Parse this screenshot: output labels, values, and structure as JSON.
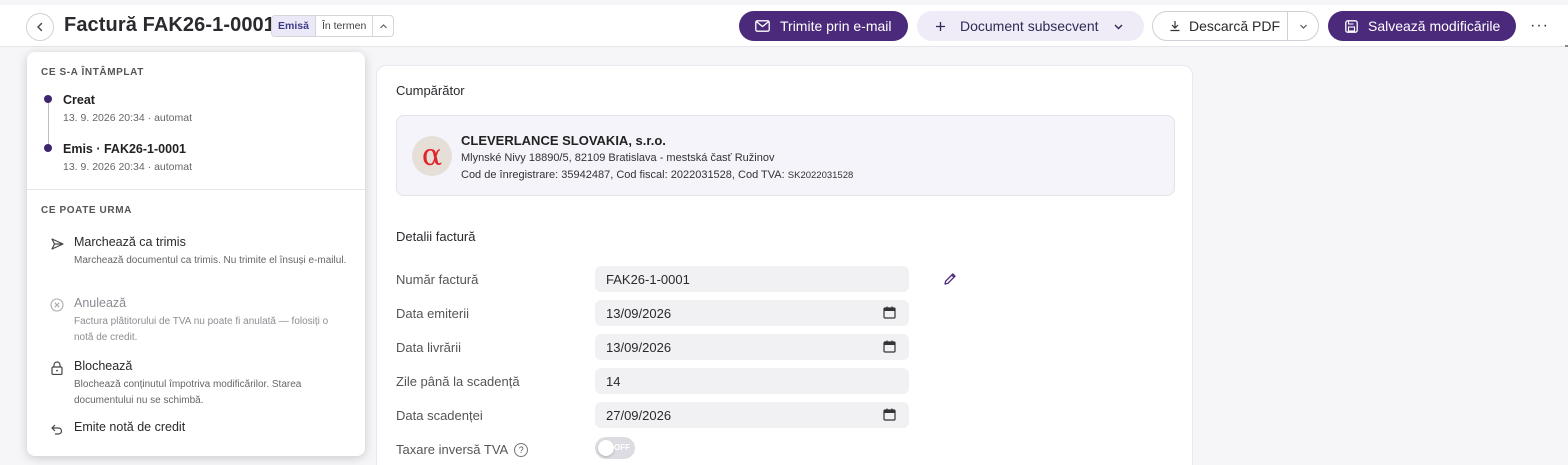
{
  "header": {
    "title": "Factură FAK26-1-0001",
    "status_segments": [
      "Emisă",
      "În termen"
    ],
    "email_button": "Trimite prin e-mail",
    "subsequent_button": "Document subsecvent",
    "pdf_button": "Descarcă PDF",
    "save_button": "Salvează modificările"
  },
  "history": {
    "title": "CE S-A ÎNTÂMPLAT",
    "events": [
      {
        "title": "Creat",
        "meta": "13. 9. 2026 20:34 · automat"
      },
      {
        "title": "Emis · FAK26-1-0001",
        "meta": "13. 9. 2026 20:34 · automat"
      }
    ]
  },
  "next": {
    "title": "CE POATE URMA",
    "actions": [
      {
        "title": "Marchează ca trimis",
        "desc": "Marchează documentul ca trimis. Nu trimite el însuși e-mailul.",
        "icon": "send-icon",
        "enabled": true
      },
      {
        "title": "Anulează",
        "desc": "Factura plătitorului de TVA nu poate fi anulată — folosiți o notă de credit.",
        "icon": "cancel-circle-icon",
        "enabled": false
      },
      {
        "title": "Blochează",
        "desc": "Blochează conținutul împotriva modificărilor. Starea documentului nu se schimbă.",
        "icon": "lock-icon",
        "enabled": true
      },
      {
        "title": "Emite notă de credit",
        "desc": "",
        "icon": "undo-icon",
        "enabled": true
      }
    ]
  },
  "buyer": {
    "section_title": "Cumpărător",
    "name": "CLEVERLANCE SLOVAKIA, s.r.o.",
    "address": "Mlynské Nivy 18890/5, 82109 Bratislava - mestská časť Ružinov",
    "ids_main": "Cod de înregistrare: 35942487, Cod fiscal: 2022031528, Cod TVA: ",
    "vat_code": "SK2022031528",
    "logo_glyph": "α",
    "logo_color": "#e2232a"
  },
  "details": {
    "section_title": "Detalii factură",
    "invoice_number_label": "Număr factură",
    "invoice_number": "FAK26-1-0001",
    "issue_date_label": "Data emiterii",
    "issue_date": "13/09/2026",
    "delivery_date_label": "Data livrării",
    "delivery_date": "13/09/2026",
    "due_days_label": "Zile până la scadență",
    "due_days": "14",
    "due_date_label": "Data scadenței",
    "due_date": "27/09/2026",
    "reverse_charge_label": "Taxare inversă TVA",
    "reverse_charge_state": "OFF"
  },
  "colors": {
    "primary": "#4b2a7b",
    "secondary_bg": "#efecf8"
  }
}
